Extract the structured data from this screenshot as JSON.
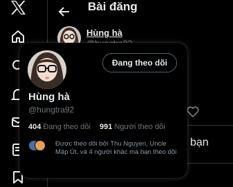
{
  "nav": {
    "icons": [
      "x-logo-icon",
      "home-icon",
      "explore-icon",
      "notifications-icon",
      "messages-icon",
      "bookmarks-icon",
      "profile-icon",
      "bookmark-icon"
    ]
  },
  "header": {
    "title": "Bài đăng"
  },
  "post": {
    "author_name": "Hùng hà",
    "author_handle": "@hungtra92"
  },
  "reply_hint": "bạn",
  "hovercard": {
    "name": "Hùng hà",
    "handle": "@hungtra92",
    "follow_button": "Đang theo dõi",
    "following_count": "404",
    "following_label": "Đang theo dõi",
    "followers_count": "991",
    "followers_label": "Người theo dõi",
    "mutual_text": "Được theo dõi bởi Thu Nguyen, Uncle Mập Út, và 4 người khác mà bạn theo dõi"
  },
  "colors": {
    "background": "#000000",
    "text": "#e7e9ea",
    "muted": "#71767b",
    "border": "#2f3336",
    "accent_red": "#e0245e"
  }
}
